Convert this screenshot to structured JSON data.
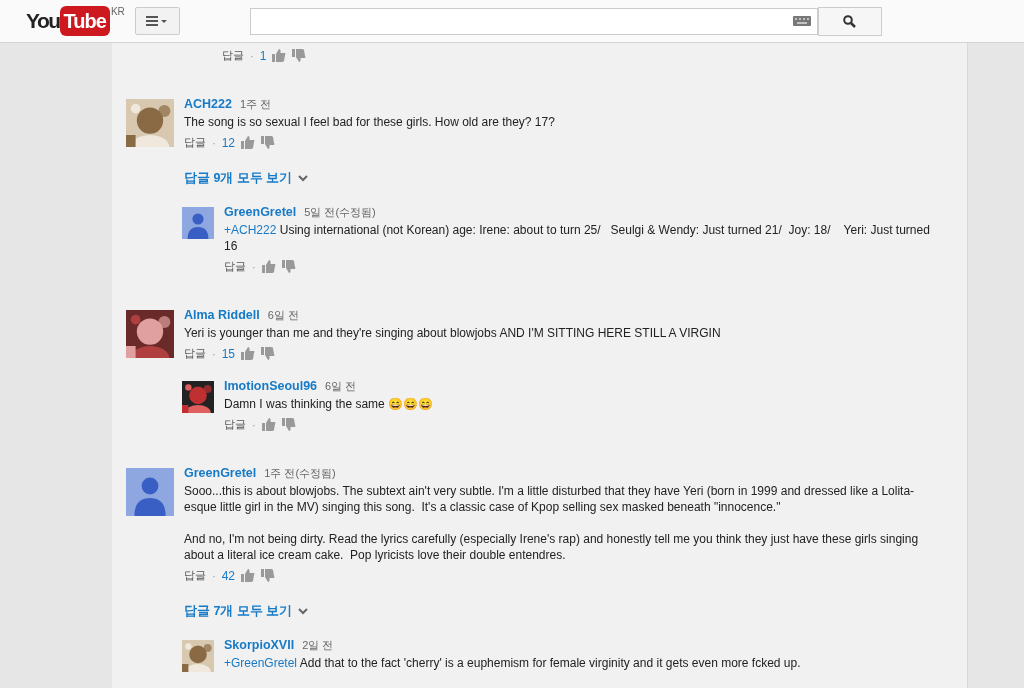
{
  "header": {
    "logo": {
      "you": "You",
      "tube": "Tube",
      "region": "KR"
    }
  },
  "top_actions": {
    "reply_label": "답글",
    "separator": "·",
    "likes": "1"
  },
  "comments": [
    {
      "author": "ACH222",
      "time": "1주 전",
      "avatar": {
        "kind": "picture"
      },
      "paragraphs": [
        "The song is so sexual I feel bad for these girls. How old are they? 17?"
      ],
      "reply_label": "답글",
      "separator": "·",
      "likes": "12",
      "replies_link": "답글 9개 모두 보기",
      "replies": [
        {
          "author": "GreenGretel",
          "time": "5일 전(수정됨)",
          "avatar": {
            "kind": "default"
          },
          "mention": "+ACH222",
          "paragraphs": [
            "Using international (not Korean) age: Irene: about to turn 25/   Seulgi & Wendy: Just turned 21/  Joy: 18/    Yeri: Just turned 16"
          ],
          "reply_label": "답글",
          "separator": "·"
        }
      ]
    },
    {
      "author": "Alma Riddell",
      "time": "6일 전",
      "avatar": {
        "kind": "picture"
      },
      "paragraphs": [
        "Yeri is younger than me and they're singing about blowjobs AND I'M SITTING HERE STILL A VIRGIN"
      ],
      "reply_label": "답글",
      "separator": "·",
      "likes": "15",
      "replies": [
        {
          "author": "ImotionSeoul96",
          "time": "6일 전",
          "avatar": {
            "kind": "picture"
          },
          "paragraphs": [
            "Damn I was thinking the same 😄😄😄"
          ],
          "reply_label": "답글",
          "separator": "·"
        }
      ]
    },
    {
      "author": "GreenGretel",
      "time": "1주 전(수정됨)",
      "avatar": {
        "kind": "default"
      },
      "paragraphs": [
        "Sooo...this is about blowjobs. The subtext ain't very subtle. I'm a little disturbed that they have Yeri (born in 1999 and dressed like a Lolita-esque little girl in the MV) singing this song.  It's a classic case of Kpop selling sex masked beneath \"innocence.\"",
        "And no, I'm not being dirty. Read the lyrics carefully (especially Irene's rap) and honestly tell me you think they just have these girls singing about a literal ice cream cake.  Pop lyricists love their double entendres."
      ],
      "reply_label": "답글",
      "separator": "·",
      "likes": "42",
      "replies_link": "답글 7개 모두 보기",
      "replies": [
        {
          "author": "SkorpioXVII",
          "time": "2일 전",
          "avatar": {
            "kind": "picture"
          },
          "mention": "+GreenGretel",
          "paragraphs": [
            "Add that to the fact 'cherry' is a euphemism for female virginity and it gets even more fcked up."
          ]
        }
      ]
    }
  ]
}
